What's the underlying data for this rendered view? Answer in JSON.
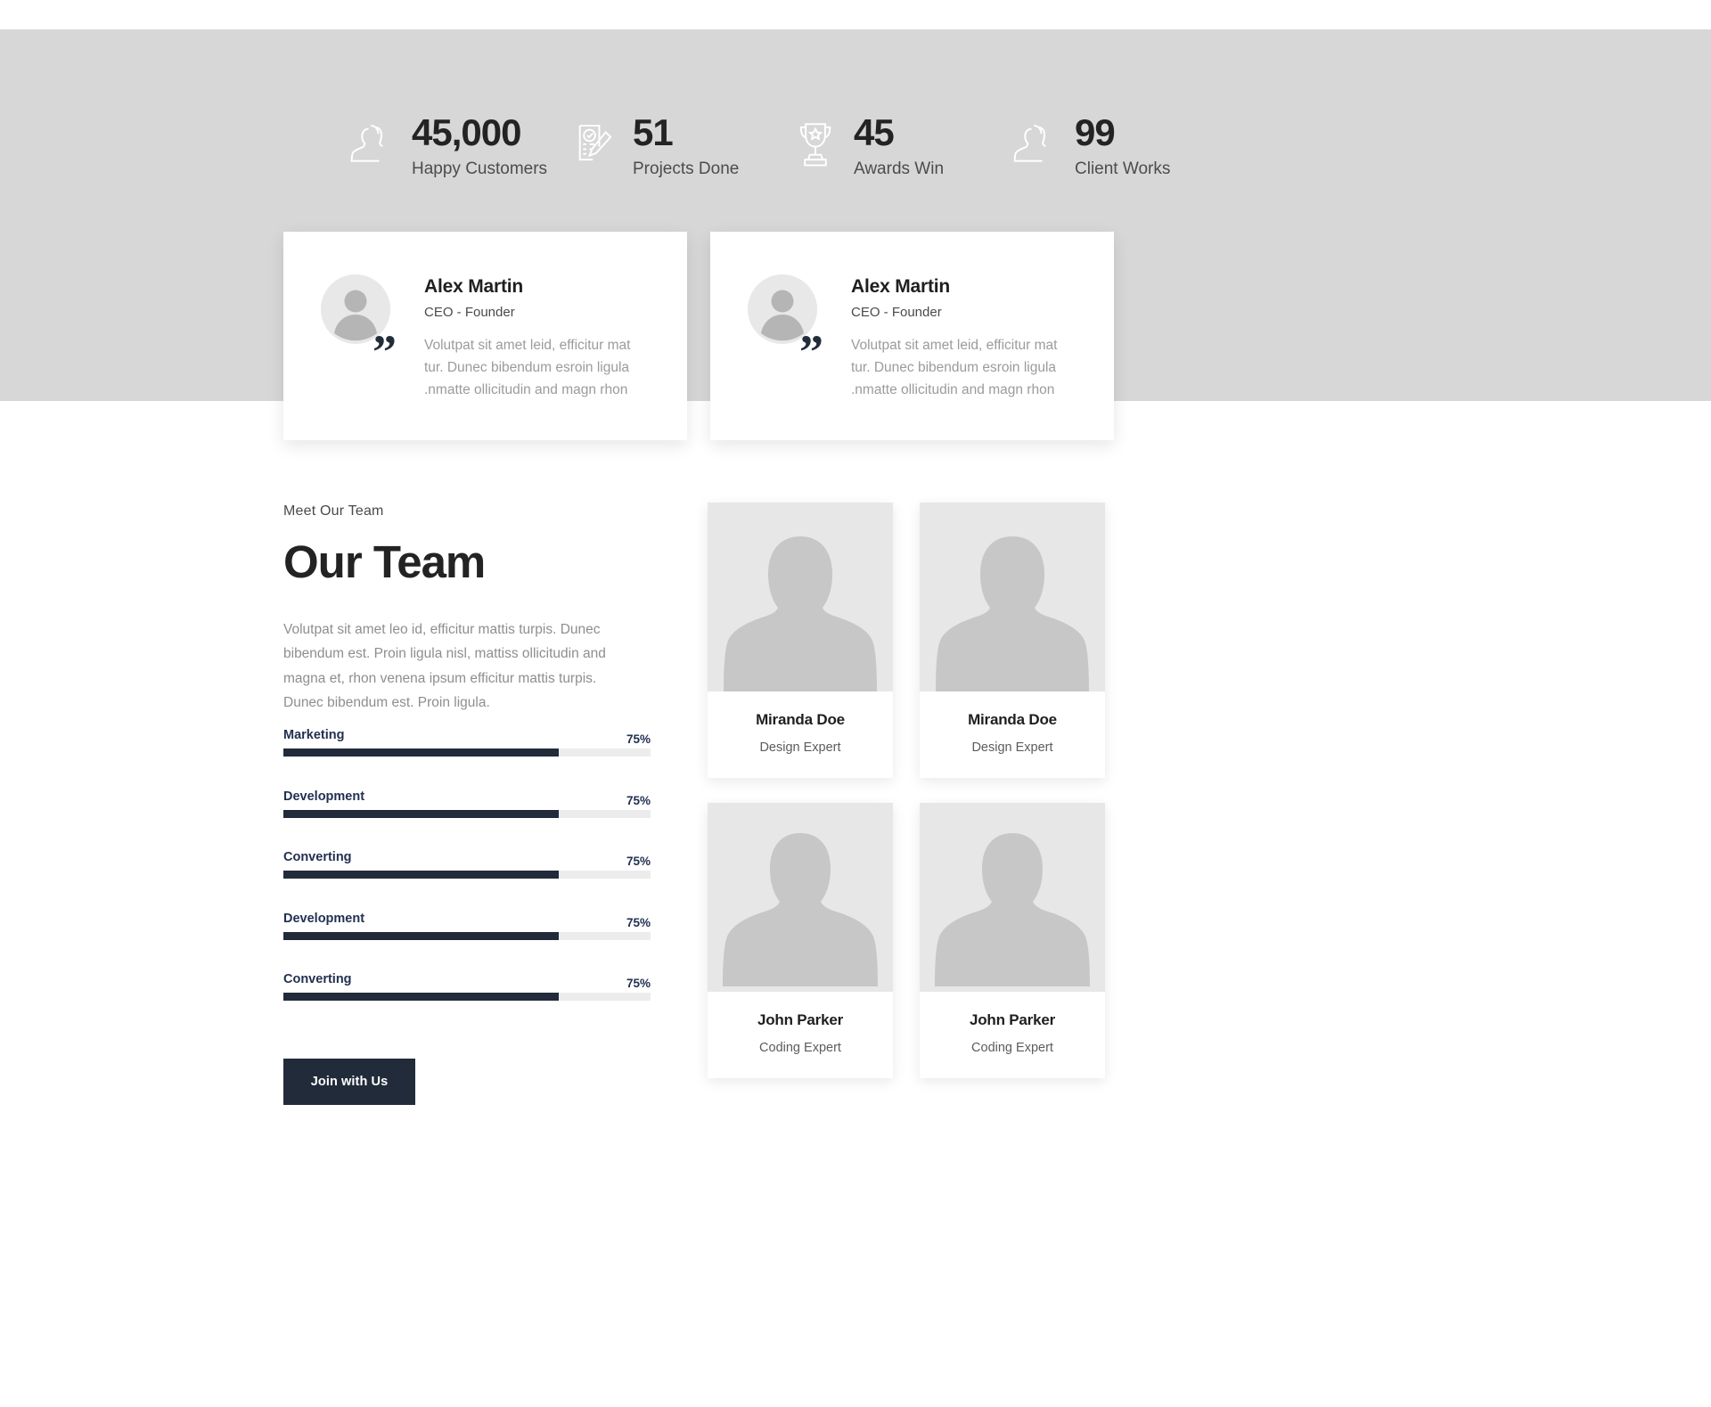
{
  "stats": [
    {
      "icon": "users-outline-icon",
      "number": "45,000",
      "label": "Happy Customers"
    },
    {
      "icon": "clipboard-pencil-icon",
      "number": "51",
      "label": "Projects Done"
    },
    {
      "icon": "trophy-icon",
      "number": "45",
      "label": "Awards Win"
    },
    {
      "icon": "users-outline-icon",
      "number": "99",
      "label": "Client Works"
    }
  ],
  "testimonials": [
    {
      "name": "Alex Martin",
      "role": "CEO - Founder",
      "quote_mark": "”",
      "text": "Volutpat sit amet leid, efficitur mat tur. Dunec bibendum esroin ligula .nmatte ollicitudin and magn rhon"
    },
    {
      "name": "Alex Martin",
      "role": "CEO - Founder",
      "quote_mark": "”",
      "text": "Volutpat sit amet leid, efficitur mat tur. Dunec bibendum esroin ligula .nmatte ollicitudin and magn rhon"
    }
  ],
  "team": {
    "eyebrow": "Meet Our Team",
    "title": "Our Team",
    "description": "Volutpat sit amet leo id, efficitur mattis turpis. Dunec bibendum est. Proin ligula nisl, mattiss ollicitudin and magna et, rhon venena ipsum efficitur mattis turpis. Dunec bibendum est. Proin ligula.",
    "cta_label": "Join with Us",
    "skills": [
      {
        "name": "Marketing",
        "percent_label": "75%",
        "percent": 75
      },
      {
        "name": "Development",
        "percent_label": "75%",
        "percent": 75
      },
      {
        "name": "Converting",
        "percent_label": "75%",
        "percent": 75
      },
      {
        "name": "Development",
        "percent_label": "75%",
        "percent": 75
      },
      {
        "name": "Converting",
        "percent_label": "75%",
        "percent": 75
      }
    ],
    "members": [
      {
        "name": "Miranda Doe",
        "role": "Design Expert",
        "avatar": "female-silhouette-icon"
      },
      {
        "name": "Miranda Doe",
        "role": "Design Expert",
        "avatar": "female-silhouette-icon"
      },
      {
        "name": "John Parker",
        "role": "Coding Expert",
        "avatar": "male-silhouette-icon"
      },
      {
        "name": "John Parker",
        "role": "Coding Expert",
        "avatar": "male-silhouette-icon"
      }
    ]
  },
  "colors": {
    "band_background": "#d7d7d7",
    "accent_dark": "#222b39",
    "skill_label": "#223050",
    "track": "#ececec",
    "photo_placeholder": "#e7e7e7"
  }
}
